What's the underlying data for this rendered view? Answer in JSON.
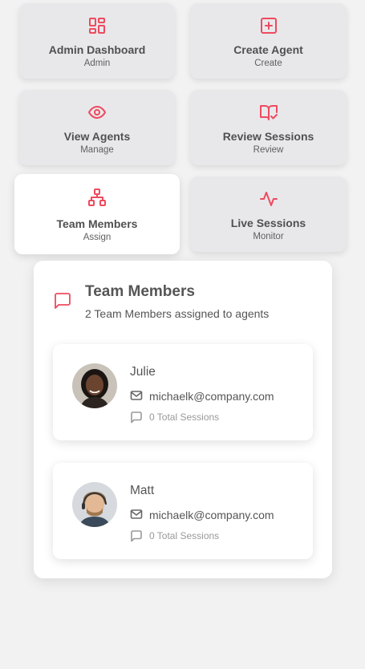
{
  "tiles": [
    {
      "title": "Admin Dashboard",
      "subtitle": "Admin",
      "icon": "dashboard-icon"
    },
    {
      "title": "Create Agent",
      "subtitle": "Create",
      "icon": "plus-square-icon"
    },
    {
      "title": "View Agents",
      "subtitle": "Manage",
      "icon": "eye-icon"
    },
    {
      "title": "Review Sessions",
      "subtitle": "Review",
      "icon": "book-check-icon"
    },
    {
      "title": "Team Members",
      "subtitle": "Assign",
      "icon": "org-chart-icon"
    },
    {
      "title": "Live Sessions",
      "subtitle": "Monitor",
      "icon": "activity-icon"
    }
  ],
  "panel": {
    "title": "Team Members",
    "subtitle": "2 Team Members assigned to agents",
    "icon": "message-square-icon"
  },
  "members": [
    {
      "name": "Julie",
      "email": "michaelk@company.com",
      "sessions": "0 Total Sessions"
    },
    {
      "name": "Matt",
      "email": "michaelk@company.com",
      "sessions": "0 Total Sessions"
    }
  ],
  "colors": {
    "accent": "#ef4a5e",
    "tile_bg": "#e8e8eb",
    "page_bg": "#f2f2f2"
  }
}
